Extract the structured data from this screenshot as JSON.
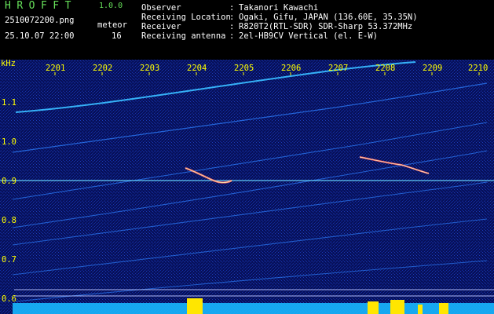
{
  "app": {
    "title": "HROFFT",
    "version": "1.0.0",
    "meteor_label": "meteor",
    "meteor_count": "16",
    "file_name": "2510072200.png",
    "datetime": "25.10.07 22:00"
  },
  "station": [
    {
      "label": "Observer",
      "colon": ":",
      "value": "Takanori Kawachi"
    },
    {
      "label": "Receiving Location",
      "colon": ":",
      "value": "Ogaki, Gifu, JAPAN (136.60E, 35.35N)"
    },
    {
      "label": "Receiver",
      "colon": ":",
      "value": "R820T2(RTL-SDR) SDR-Sharp 53.372MHz"
    },
    {
      "label": "Receiving antenna",
      "colon": ":",
      "value": "2el-HB9CV Vertical (el. E-W)"
    }
  ],
  "axis": {
    "y_unit": "kHz",
    "x_ticks": [
      "2201",
      "2202",
      "2203",
      "2204",
      "2205",
      "2206",
      "2207",
      "2208",
      "2209",
      "2210"
    ],
    "y_ticks": [
      "1.1",
      "1.0",
      "0.9",
      "0.8",
      "0.7",
      "0.6"
    ]
  },
  "colors": {
    "background": "#070b4a",
    "title_green": "#66e05a",
    "axis_yellow": "#ffff00",
    "white": "#ffffff",
    "trace": "#2f8cff",
    "meteor": "#ff3b3b",
    "noise_cyan": "#39c7ff",
    "burst_yellow": "#ffe600"
  }
}
